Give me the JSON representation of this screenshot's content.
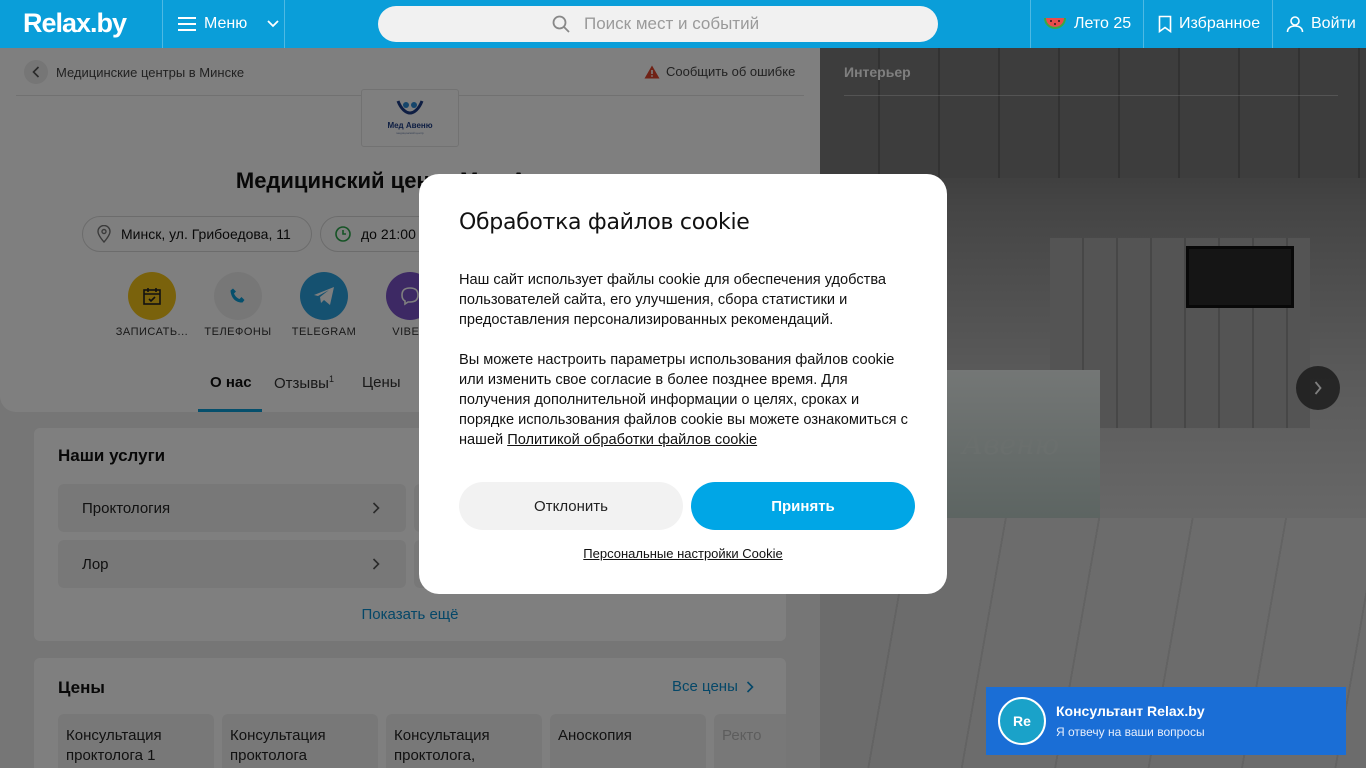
{
  "header": {
    "logo": "Relax.by",
    "menu_label": "Меню",
    "search_placeholder": "Поиск мест и событий",
    "summer_label": "Лето 25",
    "favorites_label": "Избранное",
    "login_label": "Войти"
  },
  "breadcrumb": {
    "label": "Медицинские центры в Минске"
  },
  "report_label": "Сообщить об ошибке",
  "company": {
    "logo_text": "Мед Авеню",
    "logo_subtext": "медицинский центр",
    "title": "Медицинский центр Мед Авеню",
    "address": "Минск, ул. Грибоедова, 11",
    "hours": "до 21:00"
  },
  "actions": [
    {
      "label": "ЗАПИСАТЬ...",
      "icon": "calendar-check-icon"
    },
    {
      "label": "ТЕЛЕФОНЫ",
      "icon": "phone-icon"
    },
    {
      "label": "TELEGRAM",
      "icon": "telegram-icon"
    },
    {
      "label": "VIBER",
      "icon": "viber-icon"
    }
  ],
  "tabs": [
    {
      "label": "О нас",
      "active": true
    },
    {
      "label": "Отзывы",
      "sup": "1"
    },
    {
      "label": "Цены"
    }
  ],
  "services": {
    "title": "Наши услуги",
    "items": [
      "Проктология",
      "Лор"
    ],
    "show_more": "Показать ещё"
  },
  "prices": {
    "title": "Цены",
    "all_link": "Все цены",
    "items": [
      "Консультация проктолога 1",
      "Консультация проктолога",
      "Консультация проктолога,",
      "Аноскопия",
      "Ректо"
    ]
  },
  "gallery": {
    "title": "Интерьер",
    "sign_text": "Авеню"
  },
  "cookie": {
    "title": "Обработка файлов cookie",
    "p1": "Наш сайт использует файлы cookie для обеспечения удобства пользователей сайта, его улучшения, сбора статистики и предоставления персонализированных рекомендаций.",
    "p2": "Вы можете настроить параметры использования файлов cookie или изменить свое согласие в более позднее время. Для получения дополнительной информации о целях, сроках и порядке использования файлов cookie вы можете ознакомиться с нашей",
    "policy_link": "Политикой обработки файлов cookie",
    "decline_label": "Отклонить",
    "accept_label": "Принять",
    "settings_link": "Персональные настройки Cookie"
  },
  "consultant": {
    "avatar": "Re",
    "title": "Консультант Relax.by",
    "subtitle": "Я отвечу на ваши вопросы"
  },
  "colors": {
    "brand": "#0a9ed9",
    "accept": "#00a6e6",
    "consultant": "#1a6ed6"
  }
}
